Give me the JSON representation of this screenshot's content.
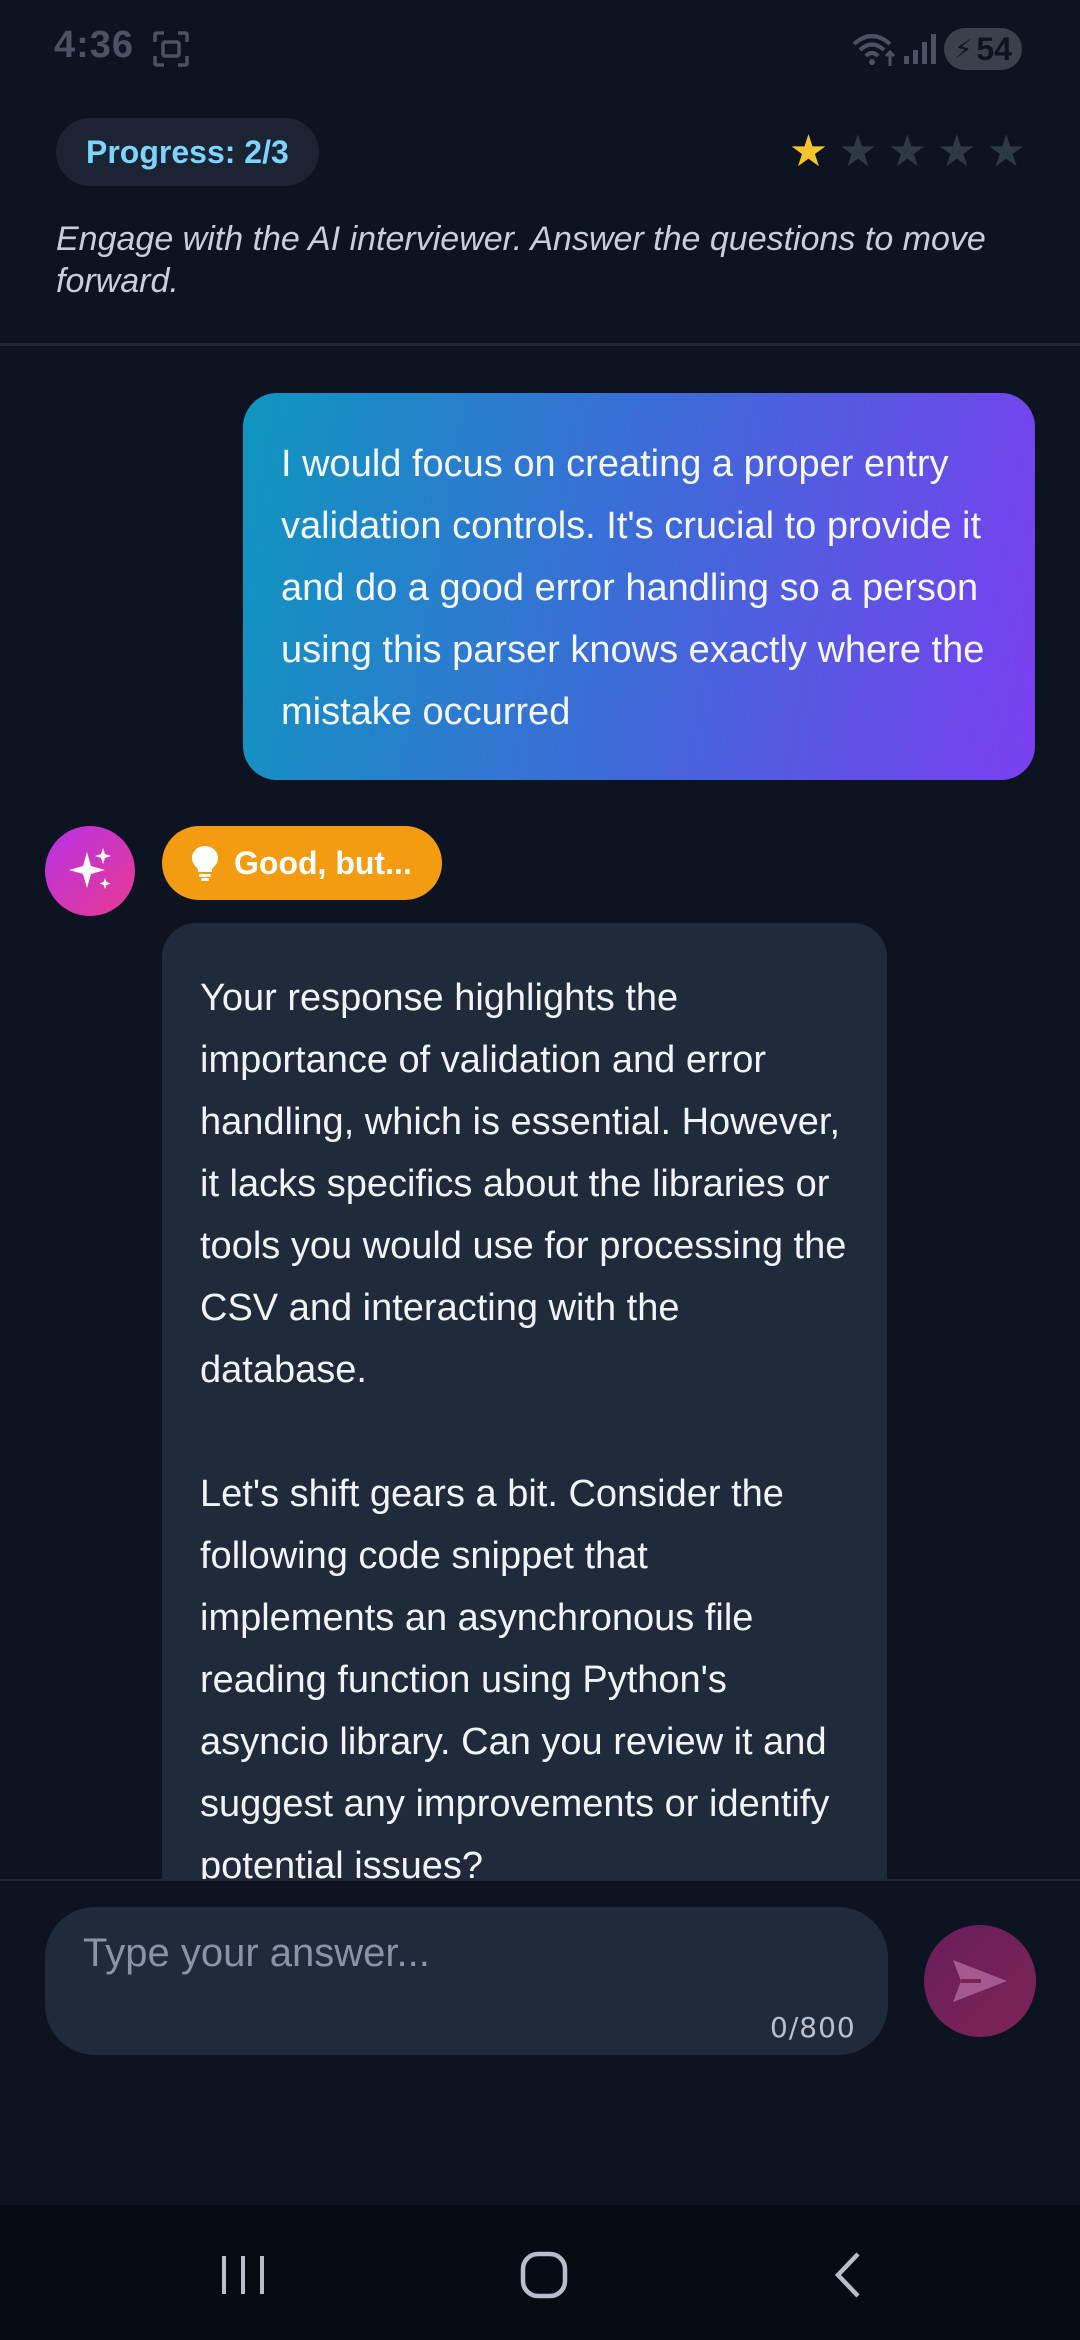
{
  "status_bar": {
    "time": "4:36",
    "battery": "54",
    "icons": [
      "screenshot-capture-icon",
      "wifi-icon",
      "signal-icon",
      "battery-charging-icon"
    ]
  },
  "header": {
    "progress_label": "Progress: 2/3",
    "rating": {
      "filled": 1,
      "total": 5
    },
    "instructions": "Engage with the AI interviewer. Answer the questions to move forward."
  },
  "chat": {
    "user_message": "I would focus on creating a proper entry validation controls. It's crucial to provide it and do a good error handling so a person using this parser knows exactly where the mistake occurred",
    "ai_feedback_label": "Good, but...",
    "ai_message_p1": "Your response highlights the importance of validation and error handling, which is essential. However, it lacks specifics about the libraries or tools you would use for processing the CSV and interacting with the database.",
    "ai_message_p2": "Let's shift gears a bit. Consider the following code snippet that implements an asynchronous file reading function using Python's asyncio library. Can you review it and suggest any improvements or identify potential issues?"
  },
  "input": {
    "placeholder": "Type your answer...",
    "value": "",
    "char_count": "0/800"
  },
  "colors": {
    "background": "#0d1421",
    "progress_text": "#7ed3ff",
    "star_filled": "#f6c52b",
    "badge": "#f39c12",
    "ai_bubble": "#1f2a3b",
    "user_gradient_start": "#0f96bf",
    "user_gradient_end": "#7a3ff0"
  }
}
